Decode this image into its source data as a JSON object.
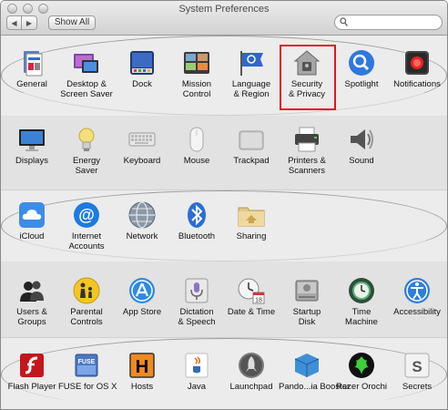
{
  "window": {
    "title": "System Preferences"
  },
  "toolbar": {
    "back": "◀",
    "forward": "▶",
    "show_all": "Show All"
  },
  "search": {
    "value": "",
    "placeholder": ""
  },
  "rows": [
    {
      "items": [
        {
          "label": "General",
          "icon": "general-icon"
        },
        {
          "label": "Desktop &\nScreen Saver",
          "icon": "desktop-icon"
        },
        {
          "label": "Dock",
          "icon": "dock-icon"
        },
        {
          "label": "Mission\nControl",
          "icon": "mission-control-icon"
        },
        {
          "label": "Language\n& Region",
          "icon": "flag-icon"
        },
        {
          "label": "Security\n& Privacy",
          "icon": "house-icon"
        },
        {
          "label": "Spotlight",
          "icon": "magnifier-icon"
        },
        {
          "label": "Notifications",
          "icon": "notifications-icon"
        }
      ]
    },
    {
      "items": [
        {
          "label": "Displays",
          "icon": "display-icon"
        },
        {
          "label": "Energy\nSaver",
          "icon": "lightbulb-icon"
        },
        {
          "label": "Keyboard",
          "icon": "keyboard-icon"
        },
        {
          "label": "Mouse",
          "icon": "mouse-icon"
        },
        {
          "label": "Trackpad",
          "icon": "trackpad-icon"
        },
        {
          "label": "Printers &\nScanners",
          "icon": "printer-icon"
        },
        {
          "label": "Sound",
          "icon": "speaker-icon"
        }
      ]
    },
    {
      "items": [
        {
          "label": "iCloud",
          "icon": "cloud-icon"
        },
        {
          "label": "Internet\nAccounts",
          "icon": "at-icon"
        },
        {
          "label": "Network",
          "icon": "globe-icon"
        },
        {
          "label": "Bluetooth",
          "icon": "bluetooth-icon"
        },
        {
          "label": "Sharing",
          "icon": "sharing-folder-icon"
        }
      ]
    },
    {
      "items": [
        {
          "label": "Users &\nGroups",
          "icon": "users-icon"
        },
        {
          "label": "Parental\nControls",
          "icon": "parental-icon"
        },
        {
          "label": "App Store",
          "icon": "app-store-icon"
        },
        {
          "label": "Dictation\n& Speech",
          "icon": "microphone-icon"
        },
        {
          "label": "Date & Time",
          "icon": "clock-calendar-icon"
        },
        {
          "label": "Startup\nDisk",
          "icon": "disk-icon"
        },
        {
          "label": "Time\nMachine",
          "icon": "time-machine-icon"
        },
        {
          "label": "Accessibility",
          "icon": "accessibility-icon"
        }
      ]
    },
    {
      "items": [
        {
          "label": "Flash Player",
          "icon": "flash-icon"
        },
        {
          "label": "FUSE for OS X",
          "icon": "fuse-icon",
          "badge": "FUSE"
        },
        {
          "label": "Hosts",
          "icon": "hosts-icon",
          "badge": "H"
        },
        {
          "label": "Java",
          "icon": "java-icon"
        },
        {
          "label": "Launchpad",
          "icon": "rocket-icon"
        },
        {
          "label": "Pando...ia Booster",
          "icon": "box-icon"
        },
        {
          "label": "Razer Orochi",
          "icon": "razer-icon"
        },
        {
          "label": "Secrets",
          "icon": "secrets-icon",
          "badge": "S"
        }
      ]
    }
  ],
  "highlight": {
    "target": "Security & Privacy",
    "color": "#e0161c"
  }
}
